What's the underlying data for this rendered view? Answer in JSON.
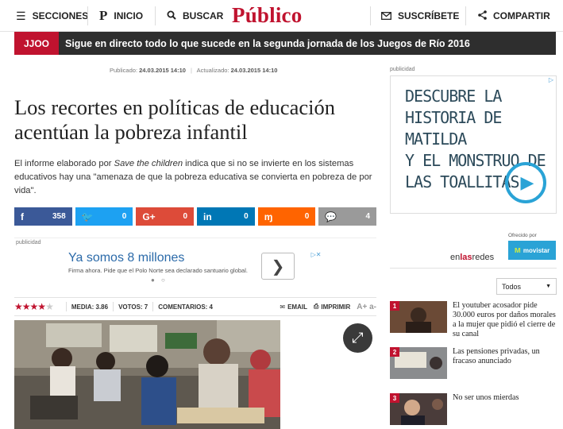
{
  "nav": {
    "sections_label": "SECCIONES",
    "home_label": "INICIO",
    "search_label": "BUSCAR",
    "logo": "Público",
    "subscribe_label": "SUSCRÍBETE",
    "share_label": "COMPARTIR"
  },
  "breaking": {
    "tag": "JJOO",
    "text": "Sigue en directo todo lo que sucede en la segunda jornada de los Juegos de Río 2016"
  },
  "article": {
    "published_label": "Publicado:",
    "published": "24.03.2015 14:10",
    "updated_label": "Actualizado:",
    "updated": "24.03.2015 14:10",
    "title": "Los recortes en políticas de educación acentúan la pobreza infantil",
    "lead_before": "El informe elaborado por ",
    "lead_italic": "Save the children",
    "lead_after": " indica que si no se invierte en los sistemas educativos hay una \"amenaza de que la pobreza educativa se convierta en pobreza de por vida\"."
  },
  "share_buttons": [
    {
      "icon": "facebook-icon",
      "glyph": "f",
      "count": "358",
      "color": "#3b5998"
    },
    {
      "icon": "twitter-icon",
      "glyph": "🐦",
      "count": "0",
      "color": "#1da1f2"
    },
    {
      "icon": "googleplus-icon",
      "glyph": "G+",
      "count": "0",
      "color": "#dd4b39"
    },
    {
      "icon": "linkedin-icon",
      "glyph": "in",
      "count": "0",
      "color": "#0077b5"
    },
    {
      "icon": "meneame-icon",
      "glyph": "ɱ",
      "count": "0",
      "color": "#ff6400"
    },
    {
      "icon": "comments-icon",
      "glyph": "💬",
      "count": "4",
      "color": "#9a9a9a"
    }
  ],
  "ad_inline": {
    "label": "publicidad",
    "headline": "Ya somos 8 millones",
    "subtext": "Firma ahora. Pide que el Polo Norte sea declarado santuario global."
  },
  "meta": {
    "rating_stars_filled": 4,
    "rating_stars_total": 5,
    "media_label": "MEDIA: 3.86",
    "votos_label": "VOTOS: 7",
    "comentarios_label": "COMENTARIOS: 4",
    "email_label": "EMAIL",
    "print_label": "IMPRIMIR",
    "font_label": "A+ a-"
  },
  "sidebar": {
    "ad_label": "publicidad",
    "ad_text_lines": [
      "DESCUBRE LA",
      "HISTORIA DE MATILDA",
      "Y EL MONSTRUO DE",
      "LAS TOALLITAS."
    ],
    "offered_by": "Ofrecido por",
    "sponsor": "movistar",
    "enlasredes_pre": "en",
    "enlasredes_bold": "las",
    "enlasredes_post": "redes",
    "filter_value": "Todos",
    "news": [
      {
        "num": "1",
        "title": "El youtuber acosador pide 30.000 euros por daños morales a la mujer que pidió el cierre de su canal"
      },
      {
        "num": "2",
        "title": "Las pensiones privadas, un fracaso anunciado"
      },
      {
        "num": "3",
        "title": "No ser unos mierdas"
      }
    ]
  },
  "colors": {
    "brand": "#c0132f",
    "dark_bar": "#2e2e2e",
    "link_blue": "#2b6aa9"
  }
}
